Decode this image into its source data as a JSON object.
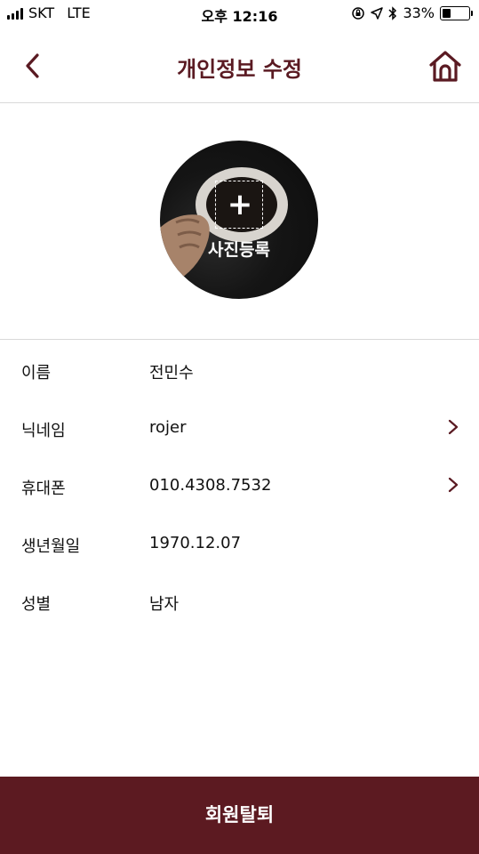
{
  "status_bar": {
    "carrier": "SKT",
    "network": "LTE",
    "time": "오후 12:16",
    "battery_percent": "33%",
    "battery_level": 0.33
  },
  "header": {
    "title": "개인정보 수정",
    "back_icon": "chevron-left-icon",
    "home_icon": "home-icon",
    "accent_color": "#5a1a22"
  },
  "profile": {
    "photo_label": "사진등록",
    "add_icon": "plus-icon"
  },
  "info": [
    {
      "label": "이름",
      "value": "전민수"
    },
    {
      "label": "닉네임",
      "value": "rojer"
    },
    {
      "label": "휴대폰",
      "value": "010.4308.7532"
    },
    {
      "label": "생년월일",
      "value": "1970.12.07"
    },
    {
      "label": "성별",
      "value": "남자"
    }
  ],
  "footer": {
    "withdraw_label": "회원탈퇴",
    "button_color": "#5c1a21"
  }
}
